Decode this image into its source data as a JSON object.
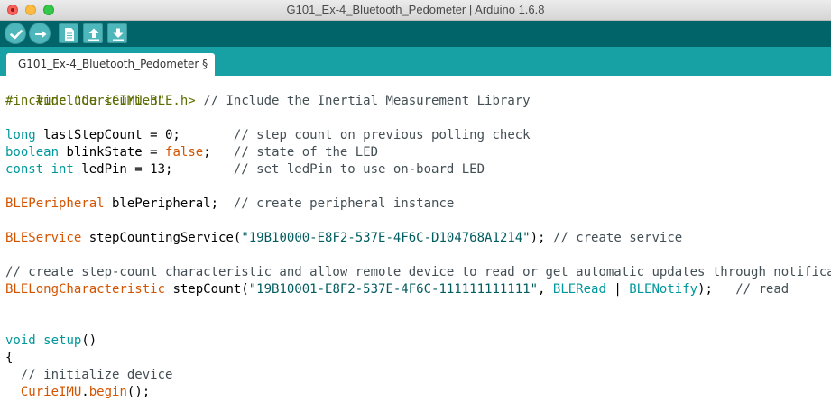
{
  "window": {
    "title": "G101_Ex-4_Bluetooth_Pedometer | Arduino 1.6.8"
  },
  "toolbar": {
    "buttons": [
      {
        "name": "verify",
        "icon": "checkmark-icon"
      },
      {
        "name": "upload",
        "icon": "right-arrow-icon"
      },
      {
        "name": "new",
        "icon": "document-icon"
      },
      {
        "name": "open",
        "icon": "up-arrow-icon"
      },
      {
        "name": "save",
        "icon": "down-arrow-icon"
      }
    ]
  },
  "tabs": [
    {
      "label": "G101_Ex-4_Bluetooth_Pedometer §"
    }
  ],
  "colors": {
    "keyword": "#00979c",
    "type": "#d35400",
    "comment": "#434f54",
    "string": "#005c5f",
    "toolbar": "#006468",
    "tabstrip": "#17a1a5"
  },
  "code": {
    "l1": {
      "a": "#include <CurieBLE.h>"
    },
    "l2": {
      "a": "#include \"CurieIMU.h\"",
      "sp": "     ",
      "c": "// Include the Inertial Measurement Library"
    },
    "l4": {
      "k": "long",
      "a": " lastStepCount = 0;",
      "sp": "       ",
      "c": "// step count on previous polling check"
    },
    "l5": {
      "k": "boolean",
      "a": " blinkState = ",
      "k2": "false",
      "b": ";",
      "sp": "   ",
      "c": "// state of the LED"
    },
    "l6": {
      "k": "const int",
      "a": " ledPin = 13;",
      "sp": "        ",
      "c": "// set ledPin to use on-board LED"
    },
    "l8": {
      "t": "BLEPeripheral",
      "a": " blePeripheral;  ",
      "c": "// create peripheral instance"
    },
    "l10": {
      "t": "BLEService",
      "a": " stepCountingService(",
      "s": "\"19B10000-E8F2-537E-4F6C-D104768A1214\"",
      "b": "); ",
      "c": "// create service"
    },
    "l12": {
      "c": "// create step-count characteristic and allow remote device to read or get automatic updates through notification"
    },
    "l13": {
      "t": "BLELongCharacteristic",
      "a": " stepCount(",
      "s": "\"19B10001-E8F2-537E-4F6C-111111111111\"",
      "b": ", ",
      "k": "BLERead",
      "d": " | ",
      "k2": "BLENotify",
      "e": ");   ",
      "c": "// read"
    },
    "l16": {
      "k": "void",
      "a": " ",
      "k2": "setup",
      "b": "()"
    },
    "l17": {
      "a": "{"
    },
    "l18": {
      "a": "  ",
      "c": "// initialize device"
    },
    "l19": {
      "a": "  ",
      "t": "CurieIMU",
      "b": ".",
      "t2": "begin",
      "e": "();"
    }
  }
}
